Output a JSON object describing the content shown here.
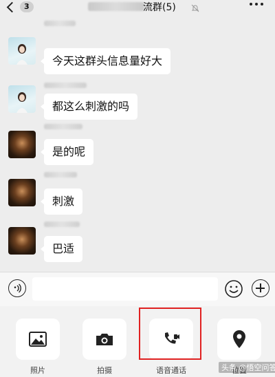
{
  "header": {
    "back_count": "3",
    "title_visible": "流群(5)"
  },
  "messages": [
    {
      "text": "今天这群头信息量好大"
    },
    {
      "text": "都这么刺激的吗"
    },
    {
      "text": "是的呢"
    },
    {
      "text": "刺激"
    },
    {
      "text": "巴适"
    }
  ],
  "tools": [
    {
      "label": "照片",
      "icon": "image-icon"
    },
    {
      "label": "拍摄",
      "icon": "camera-icon"
    },
    {
      "label": "语音通话",
      "icon": "voice-video-call-icon"
    },
    {
      "label": "位置",
      "icon": "location-icon"
    }
  ],
  "watermark": "头条 @悟空问答",
  "colors": {
    "background": "#ededed",
    "bubble": "#ffffff",
    "highlight_box": "#e02020"
  }
}
